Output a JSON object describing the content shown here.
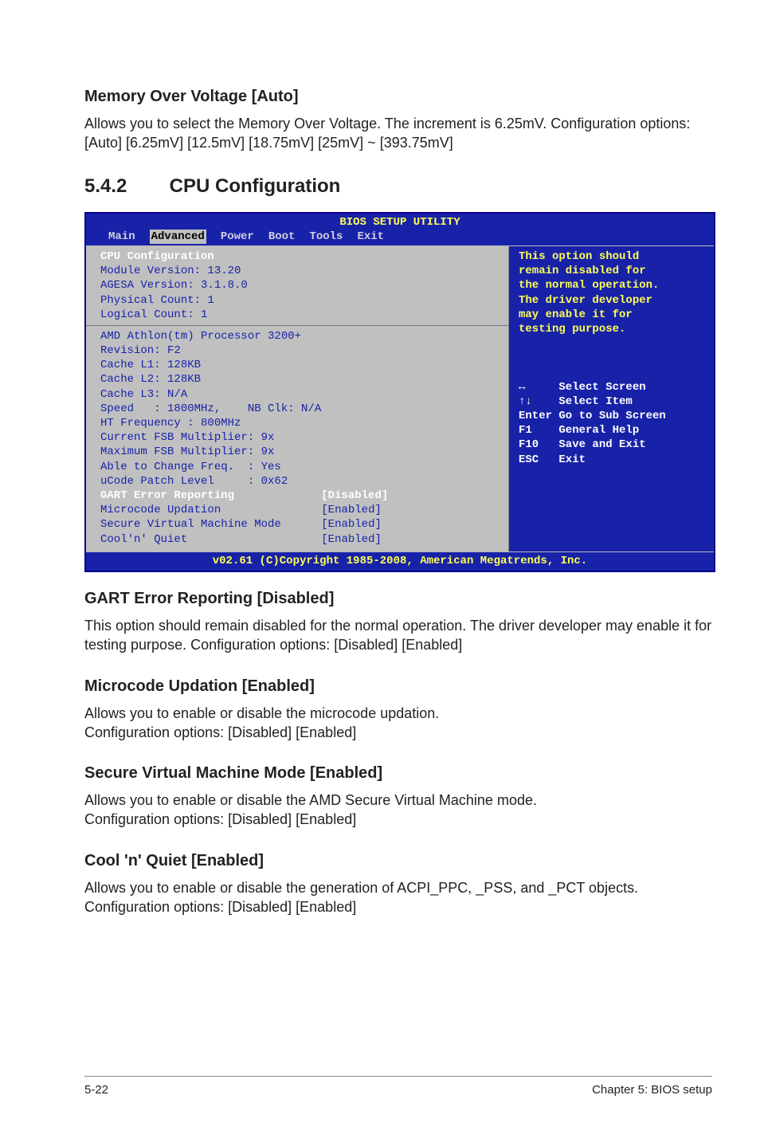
{
  "s1": {
    "h": "Memory Over Voltage [Auto]",
    "p": "Allows you to select the Memory Over Voltage. The increment is 6.25mV. Configuration options: [Auto] [6.25mV] [12.5mV] [18.75mV] [25mV] ~ [393.75mV]"
  },
  "h542_num": "5.4.2",
  "h542_txt": "CPU Configuration",
  "bios": {
    "title": "BIOS SETUP UTILITY",
    "tabs": {
      "main": "Main",
      "adv": "Advanced",
      "power": "Power",
      "boot": "Boot",
      "tools": "Tools",
      "exit": "Exit"
    },
    "left_block1_hdr": "CPU Configuration",
    "left_block1": "Module Version: 13.20\nAGESA Version: 3.1.8.0\nPhysical Count: 1\nLogical Count: 1",
    "left_block2": "AMD Athlon(tm) Processor 3200+\nRevision: F2\nCache L1: 128KB\nCache L2: 128KB\nCache L3: N/A\nSpeed   : 1800MHz,    NB Clk: N/A\nHT Frequency : 800MHz\nCurrent FSB Multiplier: 9x\nMaximum FSB Multiplier: 9x\nAble to Change Freq.  : Yes\nuCode Patch Level     : 0x62",
    "opt1_l": "GART Error Reporting",
    "opt1_v": "[Disabled]",
    "opt2_l": "Microcode Updation",
    "opt2_v": "[Enabled]",
    "opt3_l": "Secure Virtual Machine Mode",
    "opt3_v": "[Enabled]",
    "opt4_l": "Cool'n' Quiet",
    "opt4_v": "[Enabled]",
    "right_top": "This option should\nremain disabled for\nthe normal operation.\nThe driver developer\nmay enable it for\ntesting purpose.",
    "keys": "↔     Select Screen\n↑↓    Select Item\nEnter Go to Sub Screen\nF1    General Help\nF10   Save and Exit\nESC   Exit",
    "foot": "v02.61 (C)Copyright 1985-2008, American Megatrends, Inc."
  },
  "s2": {
    "h": "GART Error Reporting [Disabled]",
    "p": "This option should remain disabled for the normal operation. The driver developer may enable it for testing purpose. Configuration options: [Disabled] [Enabled]"
  },
  "s3": {
    "h": "Microcode Updation [Enabled]",
    "p": "Allows you to enable or disable the microcode updation.\nConfiguration options: [Disabled] [Enabled]"
  },
  "s4": {
    "h": "Secure Virtual Machine Mode [Enabled]",
    "p": "Allows you to enable or disable the AMD Secure Virtual Machine mode.\nConfiguration options: [Disabled] [Enabled]"
  },
  "s5": {
    "h": "Cool 'n' Quiet [Enabled]",
    "p": "Allows you to enable or disable the generation of ACPI_PPC, _PSS, and _PCT objects. Configuration options: [Disabled] [Enabled]"
  },
  "footer": {
    "left": "5-22",
    "right": "Chapter 5: BIOS setup"
  }
}
